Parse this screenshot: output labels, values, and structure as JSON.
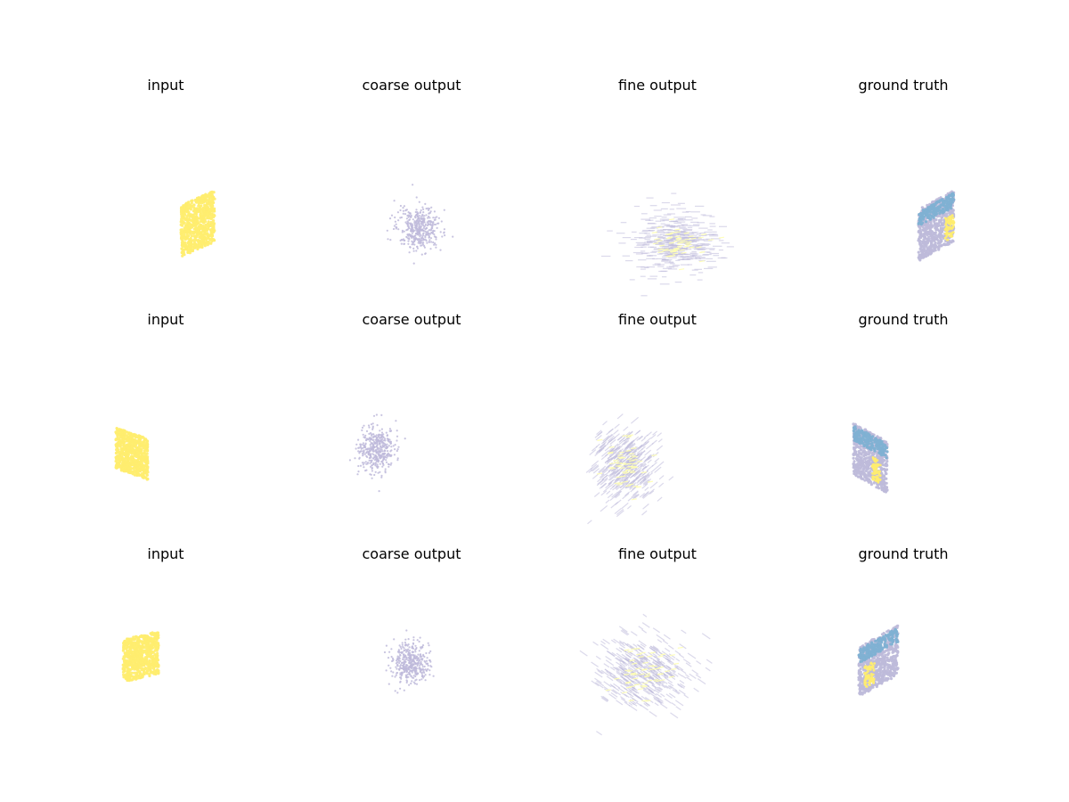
{
  "chart_data": [
    {
      "type": "scatter",
      "title": "input",
      "row": 1,
      "col": 1,
      "shape": "parallelogram",
      "series_color": "#ffed6f"
    },
    {
      "type": "scatter",
      "title": "coarse output",
      "row": 1,
      "col": 2,
      "shape": "gaussian cloud",
      "series_color": "#bebada"
    },
    {
      "type": "scatter",
      "title": "fine output",
      "row": 1,
      "col": 3,
      "shape": "patch cloud",
      "series_color": "#bebada",
      "accent_color": "#ffffb3"
    },
    {
      "type": "scatter",
      "title": "ground truth",
      "row": 1,
      "col": 4,
      "shape": "parallelogram",
      "series_colors": [
        "#bebada",
        "#80b1d3",
        "#ffed6f"
      ]
    },
    {
      "type": "scatter",
      "title": "input",
      "row": 2,
      "col": 1,
      "shape": "parallelogram",
      "series_color": "#ffed6f"
    },
    {
      "type": "scatter",
      "title": "coarse output",
      "row": 2,
      "col": 2,
      "shape": "gaussian cloud",
      "series_color": "#bebada"
    },
    {
      "type": "scatter",
      "title": "fine output",
      "row": 2,
      "col": 3,
      "shape": "patch cloud",
      "series_color": "#bebada",
      "accent_color": "#ffffb3"
    },
    {
      "type": "scatter",
      "title": "ground truth",
      "row": 2,
      "col": 4,
      "shape": "parallelogram",
      "series_colors": [
        "#bebada",
        "#80b1d3",
        "#ffed6f"
      ]
    },
    {
      "type": "scatter",
      "title": "input",
      "row": 3,
      "col": 1,
      "shape": "parallelogram",
      "series_color": "#ffed6f"
    },
    {
      "type": "scatter",
      "title": "coarse output",
      "row": 3,
      "col": 2,
      "shape": "gaussian cloud",
      "series_color": "#bebada"
    },
    {
      "type": "scatter",
      "title": "fine output",
      "row": 3,
      "col": 3,
      "shape": "patch cloud",
      "series_color": "#bebada",
      "accent_color": "#ffffb3"
    },
    {
      "type": "scatter",
      "title": "ground truth",
      "row": 3,
      "col": 4,
      "shape": "parallelogram",
      "series_colors": [
        "#bebada",
        "#80b1d3",
        "#ffed6f"
      ]
    }
  ]
}
